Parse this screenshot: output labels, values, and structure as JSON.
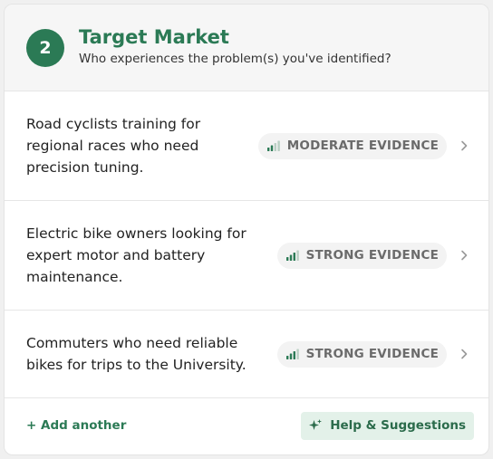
{
  "header": {
    "step_number": "2",
    "title": "Target Market",
    "subtitle": "Who experiences the problem(s) you've identified?"
  },
  "items": [
    {
      "text": "Road cyclists training for regional races who need precision tuning.",
      "evidence": "MODERATE EVIDENCE",
      "evidence_level": 2,
      "chevron_icon": "chevron-right-icon"
    },
    {
      "text": "Electric bike owners looking for expert motor and battery maintenance.",
      "evidence": "STRONG EVIDENCE",
      "evidence_level": 3,
      "chevron_icon": "chevron-right-icon"
    },
    {
      "text": "Commuters who need reliable bikes for trips to the University.",
      "evidence": "STRONG EVIDENCE",
      "evidence_level": 3,
      "chevron_icon": "chevron-right-icon"
    }
  ],
  "footer": {
    "add_label": "+ Add another",
    "help_label": "Help & Suggestions",
    "help_icon": "sparkle-icon"
  },
  "colors": {
    "accent": "#2b7a55",
    "signal_active": "#2b7a55",
    "signal_inactive": "#b9cfc3",
    "help_bg": "#e3f1e9"
  }
}
